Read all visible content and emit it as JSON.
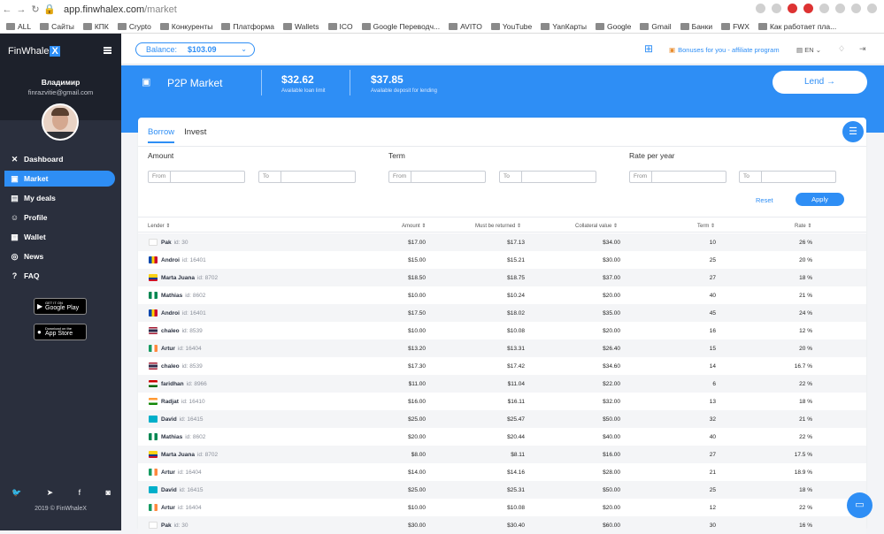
{
  "browser": {
    "url_host": "app.finwhalex.com",
    "url_path": "/market",
    "bookmarks": [
      "ALL",
      "Сайты",
      "КПК",
      "Crypto",
      "Конкуренты",
      "Платформа",
      "Wallets",
      "ICO",
      "Google Переводч...",
      "AVITO",
      "YouTube",
      "YanКарты",
      "Google",
      "Gmail",
      "Банки",
      "FWX",
      "Как работает пла..."
    ]
  },
  "sidebar": {
    "logo": "FinWhale",
    "logo_mark": "X",
    "user_name": "Владимир",
    "user_email": "finrazvitie@gmail.com",
    "menu": [
      {
        "label": "Dashboard",
        "icon": "x-icon"
      },
      {
        "label": "Market",
        "icon": "market-icon"
      },
      {
        "label": "My deals",
        "icon": "deals-icon"
      },
      {
        "label": "Profile",
        "icon": "profile-icon"
      },
      {
        "label": "Wallet",
        "icon": "wallet-icon"
      },
      {
        "label": "News",
        "icon": "news-icon"
      },
      {
        "label": "FAQ",
        "icon": "help-icon"
      }
    ],
    "google_play_small": "GET IT ON",
    "google_play": "Google Play",
    "app_store_small": "Download on the",
    "app_store": "App Store",
    "copyright": "2019 © FinWhaleX"
  },
  "topbar": {
    "balance_label": "Balance:",
    "balance_value": "$103.09",
    "bonus": "Bonuses for you - affiliate program",
    "lang": "EN"
  },
  "banner": {
    "title": "P2P Market",
    "loan_value": "$32.62",
    "loan_label": "Available loan limit",
    "deposit_value": "$37.85",
    "deposit_label": "Available deposit for lending",
    "lend_button": "Lend →"
  },
  "tabs": [
    "Borrow",
    "Invest"
  ],
  "filters": {
    "amount": "Amount",
    "term": "Term",
    "rate": "Rate per year",
    "from": "From",
    "to": "To",
    "reset": "Reset",
    "apply": "Apply"
  },
  "table": {
    "headers": [
      "Lender ⇕",
      "Amount ⇕",
      "Must be returned ⇕",
      "Collateral value ⇕",
      "Term ⇕",
      "Rate ⇕"
    ],
    "rows": [
      {
        "name": "Pak",
        "id": "id: 30",
        "amount": "$17.00",
        "ret": "$17.13",
        "coll": "$34.00",
        "term": "10",
        "rate": "26 %",
        "flag": "kr"
      },
      {
        "name": "Androi",
        "id": "id: 16401",
        "amount": "$15.00",
        "ret": "$15.21",
        "coll": "$30.00",
        "term": "25",
        "rate": "20 %",
        "flag": "md"
      },
      {
        "name": "Marta Juana",
        "id": "id: 8702",
        "amount": "$18.50",
        "ret": "$18.75",
        "coll": "$37.00",
        "term": "27",
        "rate": "18 %",
        "flag": "co"
      },
      {
        "name": "Mathias",
        "id": "id: 8602",
        "amount": "$10.00",
        "ret": "$10.24",
        "coll": "$20.00",
        "term": "40",
        "rate": "21 %",
        "flag": "ng"
      },
      {
        "name": "Androi",
        "id": "id: 16401",
        "amount": "$17.50",
        "ret": "$18.02",
        "coll": "$35.00",
        "term": "45",
        "rate": "24 %",
        "flag": "md"
      },
      {
        "name": "chaleo",
        "id": "id: 8539",
        "amount": "$10.00",
        "ret": "$10.08",
        "coll": "$20.00",
        "term": "16",
        "rate": "12 %",
        "flag": "th"
      },
      {
        "name": "Artur",
        "id": "id: 16404",
        "amount": "$13.20",
        "ret": "$13.31",
        "coll": "$26.40",
        "term": "15",
        "rate": "20 %",
        "flag": "ie"
      },
      {
        "name": "chaleo",
        "id": "id: 8539",
        "amount": "$17.30",
        "ret": "$17.42",
        "coll": "$34.60",
        "term": "14",
        "rate": "16.7 %",
        "flag": "th"
      },
      {
        "name": "faridhan",
        "id": "id: 8966",
        "amount": "$11.00",
        "ret": "$11.04",
        "coll": "$22.00",
        "term": "6",
        "rate": "22 %",
        "flag": "tj"
      },
      {
        "name": "Radjat",
        "id": "id: 16410",
        "amount": "$16.00",
        "ret": "$16.11",
        "coll": "$32.00",
        "term": "13",
        "rate": "18 %",
        "flag": "in"
      },
      {
        "name": "David",
        "id": "id: 16415",
        "amount": "$25.00",
        "ret": "$25.47",
        "coll": "$50.00",
        "term": "32",
        "rate": "21 %",
        "flag": "kz"
      },
      {
        "name": "Mathias",
        "id": "id: 8602",
        "amount": "$20.00",
        "ret": "$20.44",
        "coll": "$40.00",
        "term": "40",
        "rate": "22 %",
        "flag": "ng"
      },
      {
        "name": "Marta Juana",
        "id": "id: 8702",
        "amount": "$8.00",
        "ret": "$8.11",
        "coll": "$16.00",
        "term": "27",
        "rate": "17.5 %",
        "flag": "co"
      },
      {
        "name": "Artur",
        "id": "id: 16404",
        "amount": "$14.00",
        "ret": "$14.16",
        "coll": "$28.00",
        "term": "21",
        "rate": "18.9 %",
        "flag": "ie"
      },
      {
        "name": "David",
        "id": "id: 16415",
        "amount": "$25.00",
        "ret": "$25.31",
        "coll": "$50.00",
        "term": "25",
        "rate": "18 %",
        "flag": "kz"
      },
      {
        "name": "Artur",
        "id": "id: 16404",
        "amount": "$10.00",
        "ret": "$10.08",
        "coll": "$20.00",
        "term": "12",
        "rate": "22 %",
        "flag": "ie"
      },
      {
        "name": "Pak",
        "id": "id: 30",
        "amount": "$30.00",
        "ret": "$30.40",
        "coll": "$60.00",
        "term": "30",
        "rate": "16 %",
        "flag": "kr"
      }
    ]
  }
}
